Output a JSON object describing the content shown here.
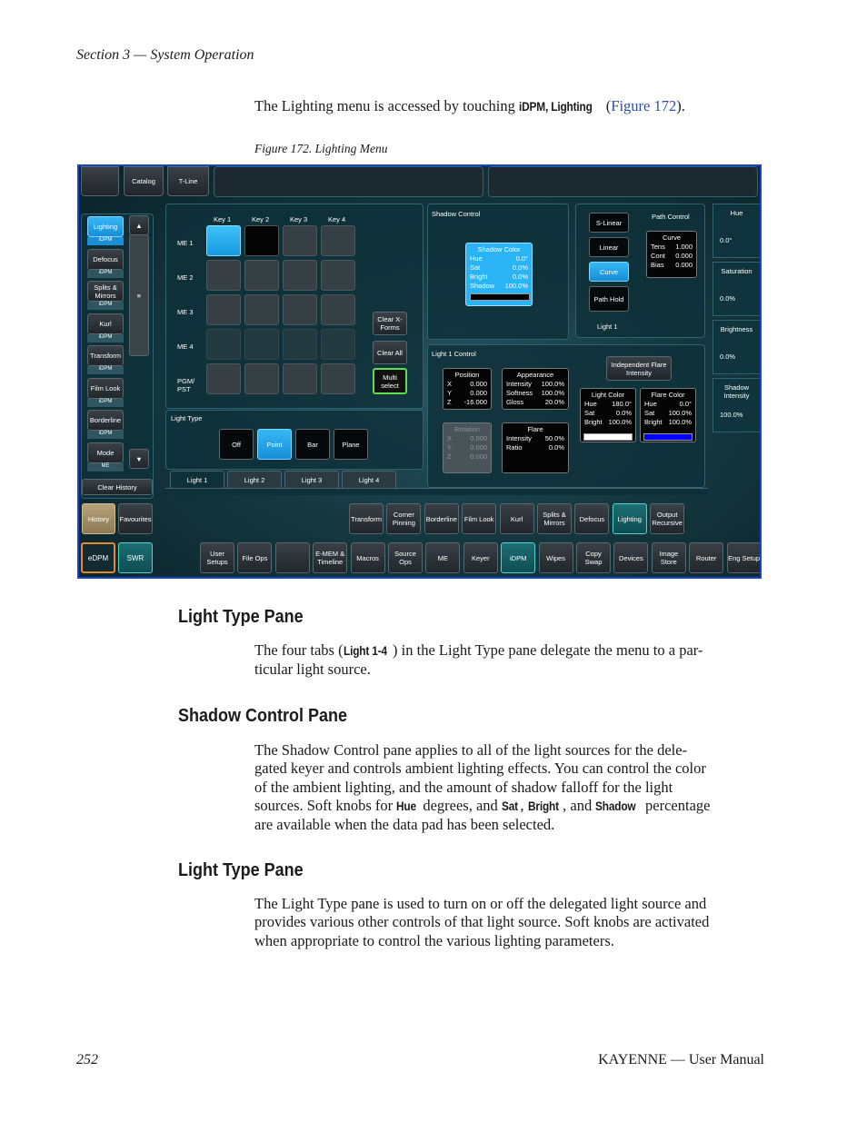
{
  "page": {
    "running_head": "Section 3 — System Operation",
    "intro": {
      "before": "The Lighting menu is accessed by touching ",
      "ui_path": "iDPM, Lighting",
      "open": " (",
      "link": "Figure 172",
      "close": ")."
    },
    "figure_caption": "Figure 172.  Lighting Menu",
    "sections": [
      {
        "heading": "Light Type Pane",
        "p1": "The four tabs (",
        "term": "Light 1-4",
        "p2": ") in the Light Type pane delegate the menu to a par-",
        "p3": "ticular light source."
      },
      {
        "heading": "Shadow Control Pane",
        "lines": [
          "The Shadow Control pane applies to all of the light sources for the dele-",
          "gated keyer and controls ambient lighting effects. You can control the color",
          "of the ambient lighting, and the amount of shadow falloff for the light"
        ],
        "l4_a": "sources. Soft knobs for ",
        "hue": "Hue",
        "l4_b": " degrees, and ",
        "sat": "Sat",
        "comma": ", ",
        "bright": "Bright",
        "l4_c": ", and ",
        "shadow": "Shadow",
        "l4_d": " percentage",
        "l5": "are available when the data pad has been selected."
      },
      {
        "heading": "Light Type Pane",
        "lines": [
          "The Light Type pane is used to turn on or off the delegated light source and",
          "provides various other controls of that light source. Soft knobs are activated",
          "when appropriate to control the various lighting parameters."
        ]
      }
    ],
    "footer_left": "252",
    "footer_right": "KAYENNE  —  User Manual"
  },
  "ui": {
    "top_tabs": [
      "",
      "Catalog",
      "T-Line"
    ],
    "left_menu": [
      {
        "label": "Lighting",
        "sub": "iDPM"
      },
      {
        "label": "Defocus",
        "sub": "iDPM"
      },
      {
        "label": "Splits & Mirrors",
        "sub": "iDPM"
      },
      {
        "label": "Kurl",
        "sub": "iDPM"
      },
      {
        "label": "Transform",
        "sub": "iDPM"
      },
      {
        "label": "Film Look",
        "sub": "iDPM"
      },
      {
        "label": "Borderline",
        "sub": "iDPM"
      },
      {
        "label": "Mode",
        "sub": "ME"
      }
    ],
    "clear_history": "Clear History",
    "history": "History",
    "favourites": "Favourites",
    "edpm": "eDPM",
    "swr": "SWR",
    "key_headers": [
      "Key 1",
      "Key 2",
      "Key 3",
      "Key 4"
    ],
    "row_labels": [
      "ME 1",
      "ME 2",
      "ME 3",
      "ME 4",
      "PGM/ PST"
    ],
    "clear_xforms": "Clear X-Forms",
    "clear_all": "Clear All",
    "multi_select": "Multi select",
    "light_type": {
      "title": "Light Type",
      "options": [
        "Off",
        "Point",
        "Bar",
        "Plane"
      ],
      "selected": "Point"
    },
    "light_tabs": [
      "Light 1",
      "Light 2",
      "Light 3",
      "Light 4"
    ],
    "shadow_control": {
      "title": "Shadow Control",
      "pad_title": "Shadow Color",
      "rows": [
        [
          "Hue",
          "0.0°"
        ],
        [
          "Sat",
          "0.0%"
        ],
        [
          "Bright",
          "0.0%"
        ],
        [
          "Shadow",
          "100.0%"
        ]
      ],
      "swatch_color": "#000000"
    },
    "path": {
      "buttons": [
        "S-Linear",
        "Linear",
        "Curve",
        "Path Hold"
      ],
      "selected": "Curve",
      "control_title": "Path Control",
      "curve_title": "Curve",
      "rows": [
        [
          "Tens",
          "1.000"
        ],
        [
          "Cont",
          "0.000"
        ],
        [
          "Bias",
          "0.000"
        ]
      ],
      "light_label": "Light 1"
    },
    "light1_control": {
      "title": "Light 1 Control",
      "position": {
        "title": "Position",
        "rows": [
          [
            "X",
            "0.000"
          ],
          [
            "Y",
            "0.000"
          ],
          [
            "Z",
            "-16.000"
          ]
        ]
      },
      "appearance": {
        "title": "Appearance",
        "rows": [
          [
            "Intensity",
            "100.0%"
          ],
          [
            "Softness",
            "100.0%"
          ],
          [
            "Gloss",
            "20.0%"
          ]
        ]
      },
      "rotation": {
        "title": "Rotation",
        "rows": [
          [
            "X",
            "0.000"
          ],
          [
            "Y",
            "0.000"
          ],
          [
            "Z",
            "0.000"
          ]
        ]
      },
      "flare": {
        "title": "Flare",
        "rows": [
          [
            "Intensity",
            "50.0%"
          ],
          [
            "Ratio",
            "0.0%"
          ]
        ]
      },
      "independent": "Independent Flare Intensity",
      "light_color": {
        "title": "Light Color",
        "rows": [
          [
            "Hue",
            "180.0°"
          ],
          [
            "Sat",
            "0.0%"
          ],
          [
            "Bright",
            "100.0%"
          ]
        ],
        "swatch": "#ffffff"
      },
      "flare_color": {
        "title": "Flare Color",
        "rows": [
          [
            "Hue",
            "0.0°"
          ],
          [
            "Sat",
            "100.0%"
          ],
          [
            "Bright",
            "100.0%"
          ]
        ],
        "swatch": "#0000ff"
      }
    },
    "knobs": [
      {
        "label": "Hue",
        "value": "0.0°"
      },
      {
        "label": "Saturation",
        "value": "0.0%"
      },
      {
        "label": "Brightness",
        "value": "0.0%"
      },
      {
        "label": "Shadow Intensity",
        "value": "100.0%"
      }
    ],
    "dpm_row": [
      "Transform",
      "Corner Pinning",
      "Borderline",
      "Film Look",
      "Kurl",
      "Splits & Mirrors",
      "Defocus",
      "Lighting",
      "Output Recursive"
    ],
    "dpm_selected": "Lighting",
    "bottom_row": [
      "User Setups",
      "File Ops",
      "",
      "E-MEM & Timeline",
      "Macros",
      "Source Ops",
      "ME",
      "Keyer",
      "iDPM",
      "Wipes",
      "Copy Swap",
      "Devices",
      "Image Store",
      "Router",
      "Eng Setup"
    ],
    "bottom_selected": "iDPM"
  }
}
